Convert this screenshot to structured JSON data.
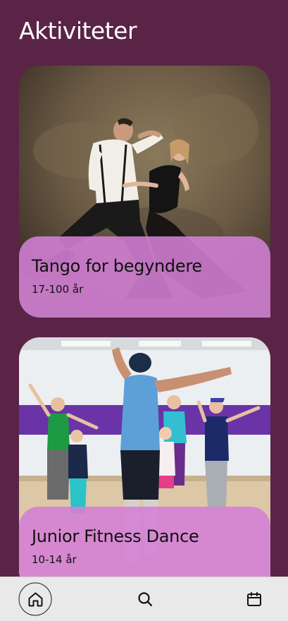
{
  "header": {
    "title": "Aktiviteter"
  },
  "activities": [
    {
      "name": "Tango for begyndere",
      "ages": "17-100 år",
      "image": "tango-couple-photo"
    },
    {
      "name": "Junior Fitness Dance",
      "ages": "10-14 år",
      "image": "kids-fitness-dance-photo"
    }
  ],
  "bottom_nav": {
    "items": [
      {
        "icon": "home-icon",
        "active": true
      },
      {
        "icon": "search-icon",
        "active": false
      },
      {
        "icon": "calendar-icon",
        "active": false
      }
    ]
  },
  "colors": {
    "background": "#5a2447",
    "card_overlay": "#d480d6",
    "nav_background": "#e9e9e9"
  }
}
